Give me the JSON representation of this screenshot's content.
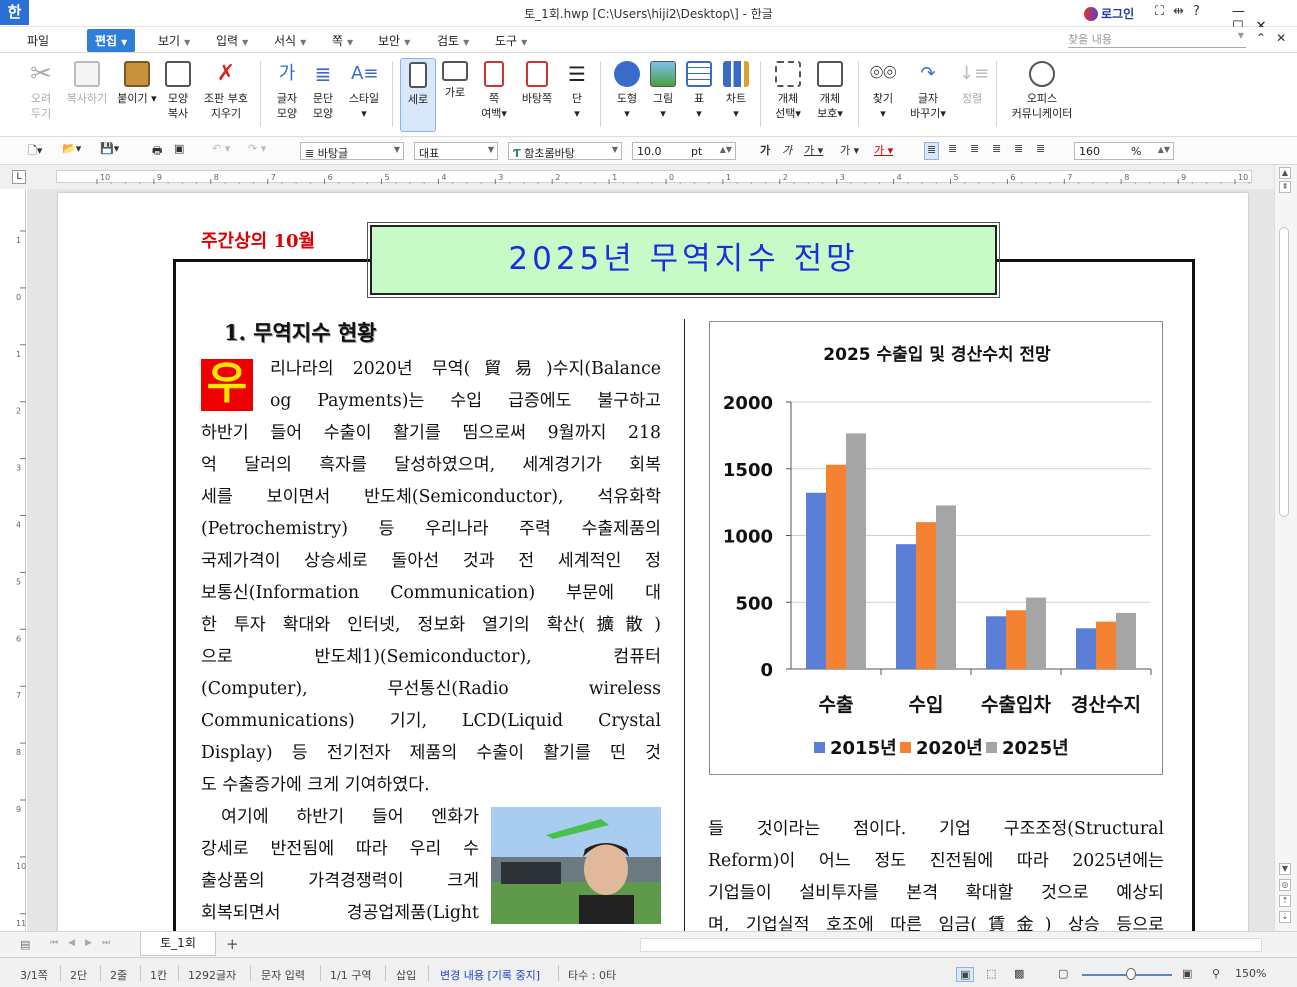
{
  "window": {
    "app_logo": "한",
    "title": "토_1회.hwp [C:\\Users\\hiji2\\Desktop\\] - 한글",
    "login": "로그인",
    "icons": [
      "fullscreen-icon",
      "split-icon",
      "help-icon"
    ],
    "controls": [
      "minimize",
      "maximize",
      "close"
    ]
  },
  "menubar": {
    "items": [
      "파일",
      "편집",
      "보기",
      "입력",
      "서식",
      "쪽",
      "보안",
      "검토",
      "도구"
    ],
    "active": "편집",
    "search_placeholder": "찾을 내용"
  },
  "ribbon": {
    "buttons": [
      {
        "label1": "오려",
        "label2": "두기",
        "icon": "scissors-icon",
        "enabled": false
      },
      {
        "label1": "복사하기",
        "label2": "",
        "icon": "copy-icon",
        "enabled": false
      },
      {
        "label1": "붙이기",
        "label2": "",
        "icon": "paste-icon",
        "enabled": true
      },
      {
        "label1": "모양",
        "label2": "복사",
        "icon": "format-painter-icon",
        "enabled": true
      },
      {
        "label1": "조판 부호",
        "label2": "지우기",
        "icon": "clear-marks-icon",
        "enabled": true
      },
      {
        "label1": "글자",
        "label2": "모양",
        "icon": "char-shape-icon",
        "enabled": true
      },
      {
        "label1": "문단",
        "label2": "모양",
        "icon": "para-shape-icon",
        "enabled": true
      },
      {
        "label1": "스타일",
        "label2": "",
        "icon": "style-icon",
        "enabled": true
      },
      {
        "label1": "세로",
        "label2": "",
        "icon": "portrait-icon",
        "enabled": true,
        "selected": true
      },
      {
        "label1": "가로",
        "label2": "",
        "icon": "landscape-icon",
        "enabled": true
      },
      {
        "label1": "쪽",
        "label2": "여백",
        "icon": "margin-icon",
        "enabled": true
      },
      {
        "label1": "바탕쪽",
        "label2": "",
        "icon": "master-page-icon",
        "enabled": true
      },
      {
        "label1": "단",
        "label2": "",
        "icon": "columns-icon",
        "enabled": true
      },
      {
        "label1": "도형",
        "label2": "",
        "icon": "shape-icon",
        "enabled": true
      },
      {
        "label1": "그림",
        "label2": "",
        "icon": "picture-icon",
        "enabled": true
      },
      {
        "label1": "표",
        "label2": "",
        "icon": "table-icon",
        "enabled": true
      },
      {
        "label1": "차트",
        "label2": "",
        "icon": "chart-icon",
        "enabled": true
      },
      {
        "label1": "개체",
        "label2": "선택",
        "icon": "object-select-icon",
        "enabled": true
      },
      {
        "label1": "개체",
        "label2": "보호",
        "icon": "object-protect-icon",
        "enabled": true
      },
      {
        "label1": "찾기",
        "label2": "",
        "icon": "binoculars-icon",
        "enabled": true
      },
      {
        "label1": "글자",
        "label2": "바꾸기",
        "icon": "replace-icon",
        "enabled": true
      },
      {
        "label1": "정렬",
        "label2": "",
        "icon": "sort-icon",
        "enabled": false
      },
      {
        "label1": "오피스",
        "label2": "커뮤니케이터",
        "icon": "communicator-icon",
        "enabled": true
      }
    ]
  },
  "format_bar": {
    "style": "바탕글",
    "lang": "대표",
    "font": "함초롬바탕",
    "size": "10.0",
    "unit": "pt",
    "zoom": "160",
    "zoom_unit": "%",
    "char_buttons": [
      "가",
      "가",
      "가",
      "가",
      "가"
    ]
  },
  "ruler": {
    "ticks": [
      "10",
      "9",
      "8",
      "7",
      "6",
      "5",
      "4",
      "3",
      "2",
      "1",
      "0",
      "1",
      "2",
      "3",
      "4",
      "5",
      "6",
      "7",
      "8",
      "9",
      "10"
    ],
    "vticks": [
      "1",
      "0",
      "1",
      "2",
      "3",
      "4",
      "5",
      "6",
      "7",
      "8",
      "9",
      "10",
      "11"
    ]
  },
  "document": {
    "header_left": "주간상의 10월",
    "title": "2025년 무역지수 전망",
    "section_title": "1. 무역지수 현황",
    "dropcap": "우",
    "para1_lines": [
      "리나라의 2020년 무역(貿易)수지(Balance",
      "og Payments)는 수입 급증에도 불구하고",
      "하반기 들어 수출이 활기를 띰으로써 9월까지 218",
      "억 달러의 흑자를 달성하였으며, 세계경기가 회복",
      "세를 보이면서 반도체(Semiconductor), 석유화학",
      "(Petrochemistry) 등 우리나라 주력 수출제품의",
      "국제가격이 상승세로 돌아선 것과 전 세계적인 정",
      "보통신(Information Communication) 부문에 대",
      "한 투자 확대와 인터넷, 정보화 열기의 확산(擴散)",
      "으로 반도체1)(Semiconductor), 컴퓨터",
      "(Computer), 무선통신(Radio wireless",
      "Communications) 기기, LCD(Liquid Crystal",
      "Display) 등 전기전자 제품의 수출이 활기를 띤 것",
      "도 수출증가에 크게 기여하였다."
    ],
    "para2_lines": [
      "여기에 하반기 들어 엔화가",
      "강세로 반전됨에 따라 우리 수",
      "출상품의 가격경쟁력이 크게",
      "회복되면서 경공업제품(Light"
    ],
    "right_lines": [
      "들 것이라는 점이다. 기업 구조조정(Structural",
      "Reform)이 어느 정도 진전됨에 따라 2025년에는",
      "기업들이 설비투자를 본격 확대할 것으로 예상되",
      "며, 기업실적 호조에 따른 임금(賃金) 상승 등으로"
    ]
  },
  "chart_data": {
    "type": "bar",
    "title": "2025 수출입 및 경산수치 전망",
    "categories": [
      "수출",
      "수입",
      "수출입차",
      "경산수지"
    ],
    "series": [
      {
        "name": "2015년",
        "values": [
          1320,
          935,
          395,
          305
        ],
        "color": "#5b7fd6"
      },
      {
        "name": "2020년",
        "values": [
          1530,
          1100,
          440,
          355
        ],
        "color": "#f58233"
      },
      {
        "name": "2025년",
        "values": [
          1765,
          1225,
          535,
          420
        ],
        "color": "#a5a5a5"
      }
    ],
    "ylim": [
      0,
      2000
    ],
    "yticks": [
      "2000",
      "1500",
      "1000",
      "500",
      "0"
    ],
    "grid": true,
    "legend": "bottom"
  },
  "tabs": {
    "doc_tab": "토_1회",
    "add": "+"
  },
  "status": {
    "page": "3/1쪽",
    "column": "2단",
    "line": "2줄",
    "col": "1칸",
    "chars": "1292글자",
    "mode": "문자 입력",
    "section": "1/1 구역",
    "insert": "삽입",
    "track": "변경 내용 [기록 중지]",
    "typos": "타수 : 0타",
    "zoom": "150%"
  }
}
